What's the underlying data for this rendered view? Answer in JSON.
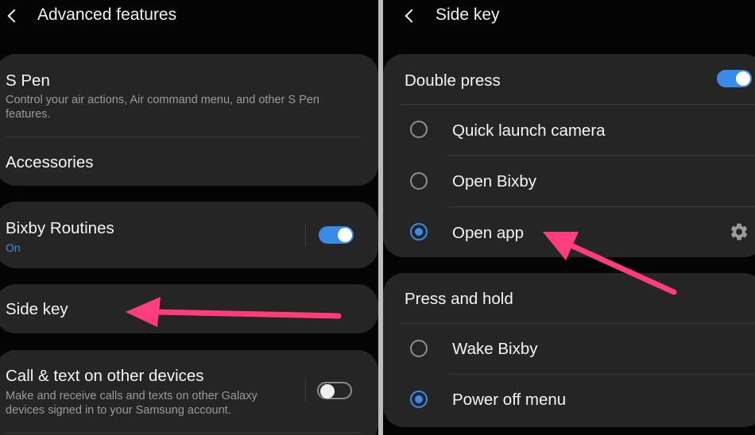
{
  "left": {
    "header": {
      "title": "Advanced features"
    },
    "items": [
      {
        "title": "S Pen",
        "desc": "Control your air actions, Air command menu, and other S Pen features."
      },
      {
        "title": "Accessories"
      },
      {
        "title": "Bixby Routines",
        "status": "On",
        "toggle": "on"
      },
      {
        "title": "Side key"
      },
      {
        "title": "Call & text on other devices",
        "desc": "Make and receive calls and texts on other Galaxy devices signed in to your Samsung account.",
        "toggle": "off"
      }
    ]
  },
  "right": {
    "header": {
      "title": "Side key"
    },
    "double_press": {
      "title": "Double press",
      "toggle": "on",
      "options": [
        {
          "label": "Quick launch camera",
          "selected": false
        },
        {
          "label": "Open Bixby",
          "selected": false
        },
        {
          "label": "Open app",
          "selected": true,
          "icon": "gear-icon"
        }
      ]
    },
    "press_and_hold": {
      "title": "Press and hold",
      "options": [
        {
          "label": "Wake Bixby",
          "selected": false
        },
        {
          "label": "Power off menu",
          "selected": true
        }
      ]
    }
  },
  "annotation_color": "#ff3d7a"
}
